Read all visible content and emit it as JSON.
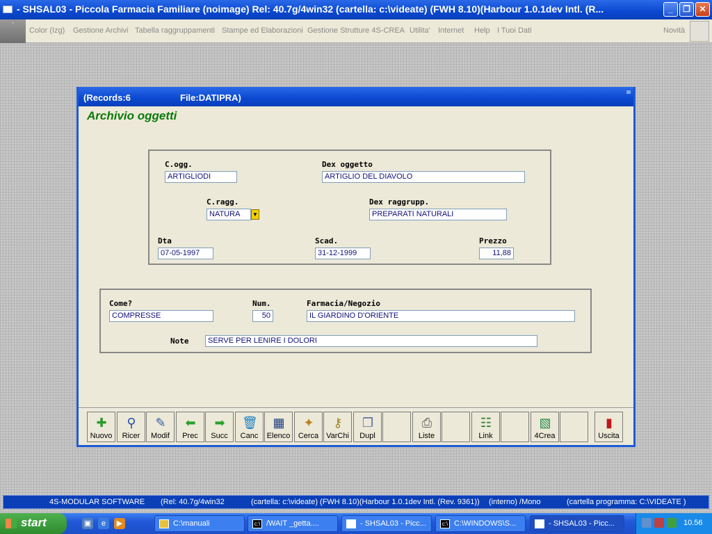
{
  "titlebar": {
    "title": "- SHSAL03 - Piccola Farmacia Familiare          (noimage)   Rel: 40.7g/4win32          (cartella: c:\\videate) (FWH 8.10)(Harbour 1.0.1dev Intl. (R..."
  },
  "menu": {
    "items": [
      "Color (Izg)",
      "Gestione Archivi",
      "Tabella raggruppamenti",
      "Stampe ed Elaborazioni",
      "Gestione Strutture 4S-CREA",
      "Utilita'",
      "Internet",
      "Help",
      "I Tuoi Dati"
    ],
    "right_item": "Novità"
  },
  "window": {
    "records_label": "(Records:6",
    "file_label": "File:DATIPRA)",
    "heading": "Archivio oggetti"
  },
  "form1": {
    "cogg_label": "C.ogg.",
    "cogg_value": "ARTIGLIODI",
    "dex_oggetto_label": "Dex oggetto",
    "dex_oggetto_value": "ARTIGLIO DEL DIAVOLO",
    "cragg_label": "C.ragg.",
    "cragg_value": "NATURA",
    "dex_raggrupp_label": "Dex raggrupp.",
    "dex_raggrupp_value": "PREPARATI NATURALI",
    "dta_label": "Dta",
    "dta_value": "07-05-1997",
    "scad_label": "Scad.",
    "scad_value": "31-12-1999",
    "prezzo_label": "Prezzo",
    "prezzo_value": "11,88"
  },
  "form2": {
    "come_label": "Come?",
    "come_value": "COMPRESSE",
    "num_label": "Num.",
    "num_value": "50",
    "farmacia_label": "Farmacia/Negozio",
    "farmacia_value": "IL GIARDINO D'ORIENTE",
    "note_label": "Note",
    "note_value": "SERVE PER LENIRE I DOLORI"
  },
  "toolbar": {
    "buttons": [
      "Nuovo",
      "Ricer",
      "Modif",
      "Prec",
      "Succ",
      "Canc",
      "Elenco",
      "Cerca",
      "VarChi",
      "Dupl",
      "",
      "Liste",
      "",
      "Link",
      "",
      "4Crea",
      "",
      "Uscita"
    ]
  },
  "statusbar": {
    "software": "4S-MODULAR SOFTWARE",
    "rel": "(Rel: 40.7g/4win32",
    "cartella": "(cartella: c:\\videate) (FWH 8.10)(Harbour 1.0.1dev Intl. (Rev. 9361))",
    "mode": "(interno)  /Mono",
    "program": "(cartella programma: C:\\VIDEATE )"
  },
  "taskbar": {
    "start_label": "start",
    "tasks": [
      "C:\\manuali",
      "/WAIT _getta....",
      "- SHSAL03 - Picc...",
      "C:\\WINDOWS\\S...",
      "- SHSAL03 - Picc..."
    ],
    "clock": "10.56"
  },
  "colors": {
    "title_blue": "#0a48d0",
    "heading_green": "#0b7a0b",
    "field_text": "#10107a",
    "window_bg": "#ece9d8"
  }
}
